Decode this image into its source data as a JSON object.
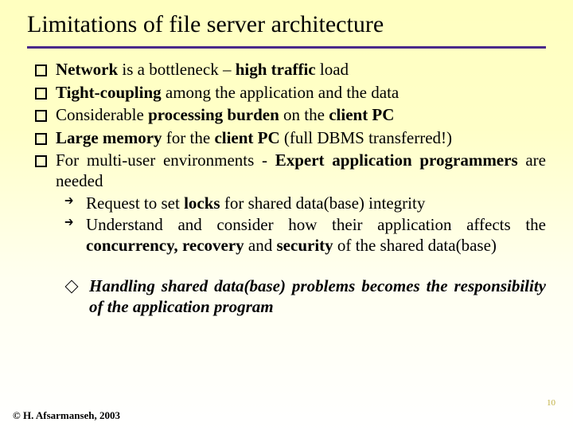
{
  "title": "Limitations of file server architecture",
  "bullets": {
    "b1_pre": "Network",
    "b1_mid": " is a bottleneck – ",
    "b1_bold2": "high traffic",
    "b1_post": " load",
    "b2_bold1": "Tight-coupling",
    "b2_post": " among the application and the data",
    "b3_pre": "Considerable ",
    "b3_bold1": "processing burden",
    "b3_mid": " on the ",
    "b3_bold2": "client PC",
    "b4_bold1": "Large memory",
    "b4_mid": " for the ",
    "b4_bold2": "client PC",
    "b4_post": "  (full DBMS transferred!)",
    "b5_pre": "For multi-user environments - ",
    "b5_bold1": "Expert application programmers",
    "b5_post": " are needed"
  },
  "subs": {
    "s1_pre": "Request to set ",
    "s1_bold": "locks",
    "s1_post": " for shared data(base) integrity",
    "s2_pre": "Understand and consider how their application affects the ",
    "s2_b1": "concurrency,",
    "s2_m1": " ",
    "s2_b2": "recovery",
    "s2_m2": " and ",
    "s2_b3": "security",
    "s2_post": " of the shared data(base)"
  },
  "diamond": "Handling shared data(base) problems becomes the responsibility of the application program",
  "copyright": "© H. Afsarmanseh, 2003",
  "pagenum": "10"
}
